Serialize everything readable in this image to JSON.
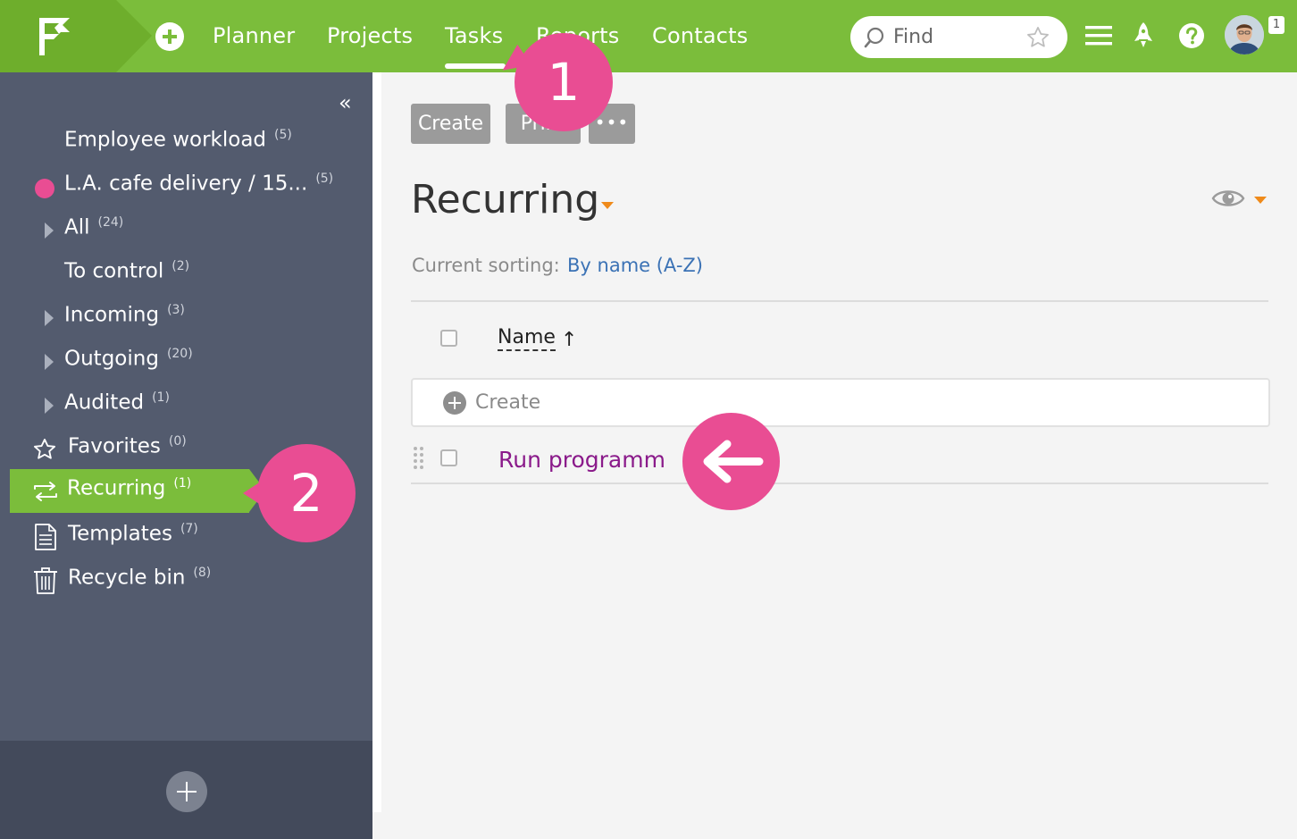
{
  "nav": {
    "items": [
      "Planner",
      "Projects",
      "Tasks",
      "Reports",
      "Contacts"
    ],
    "active": "Tasks",
    "search_placeholder": "Find",
    "notification_count": "1"
  },
  "sidebar": {
    "items": [
      {
        "label": "Employee workload",
        "count": "(5)"
      },
      {
        "label": "L.A. cafe delivery / 15...",
        "count": "(5)"
      },
      {
        "label": "All",
        "count": "(24)"
      },
      {
        "label": "To control",
        "count": "(2)"
      },
      {
        "label": "Incoming",
        "count": "(3)"
      },
      {
        "label": "Outgoing",
        "count": "(20)"
      },
      {
        "label": "Audited",
        "count": "(1)"
      },
      {
        "label": "Favorites",
        "count": "(0)"
      },
      {
        "label": "Recurring",
        "count": "(1)"
      },
      {
        "label": "Templates",
        "count": "(7)"
      },
      {
        "label": "Recycle bin",
        "count": "(8)"
      }
    ],
    "active": "Recurring"
  },
  "toolbar": {
    "create_label": "Create",
    "print_label": "Print",
    "more_label": "•••"
  },
  "main": {
    "title": "Recurring",
    "sort_label": "Current sorting:",
    "sort_value": "By name (A-Z)",
    "column_name": "Name",
    "sort_arrow": "↑",
    "quick_create_label": "Create",
    "tasks": [
      {
        "name": "Run programm"
      }
    ]
  },
  "markers": {
    "m1": "1",
    "m2": "2"
  },
  "colors": {
    "brand_green": "#7bbd3b",
    "sidebar_bg": "#535b6e",
    "marker_pink": "#e94d93",
    "accent_orange": "#ef8a1a",
    "link_blue": "#3b72b5",
    "task_purple": "#8a1a8a"
  },
  "icons": {
    "logo": "flag-logo-icon",
    "add": "plus-circle-icon",
    "search": "search-icon",
    "favorite": "star-icon",
    "menu": "hamburger-menu-icon",
    "launch": "rocket-icon",
    "help": "help-icon",
    "collapse": "double-chevron-left-icon",
    "visibility": "eye-icon",
    "drag": "drag-handle-icon"
  }
}
